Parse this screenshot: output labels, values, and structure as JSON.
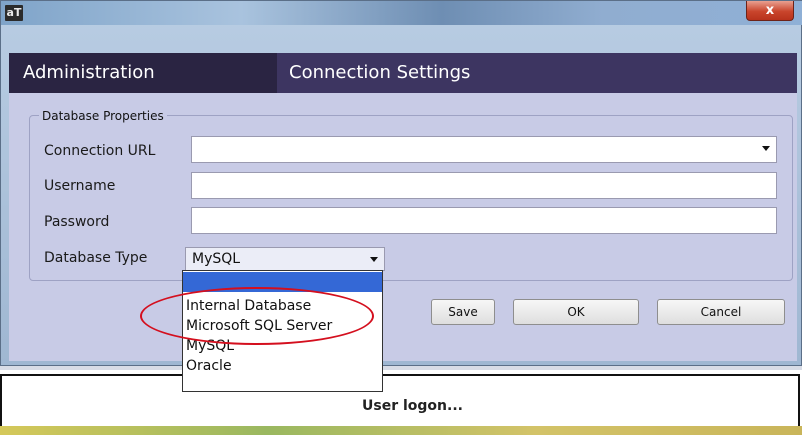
{
  "window": {
    "app_icon_text": "aT",
    "close_glyph": "x",
    "accent_close": "#c9452c"
  },
  "header": {
    "left_title": "Administration",
    "right_title": "Connection Settings"
  },
  "form": {
    "legend": "Database Properties",
    "connection_url_label": "Connection URL",
    "connection_url_value": "",
    "username_label": "Username",
    "username_value": "",
    "password_label": "Password",
    "password_value": "",
    "database_type_label": "Database Type",
    "database_type_value": "MySQL"
  },
  "dropdown": {
    "options": [
      "",
      "Internal Database",
      "Microsoft SQL Server",
      "MySQL",
      "Oracle"
    ],
    "highlighted_index": 0
  },
  "buttons": {
    "save": "Save",
    "ok": "OK",
    "cancel": "Cancel"
  },
  "background_window": {
    "status": "User logon..."
  },
  "colors": {
    "header_left": "#2a2442",
    "header_right": "#3d3561",
    "content_bg": "#c8cbe6",
    "selection": "#3468d6",
    "annotation": "#d40f1e"
  }
}
